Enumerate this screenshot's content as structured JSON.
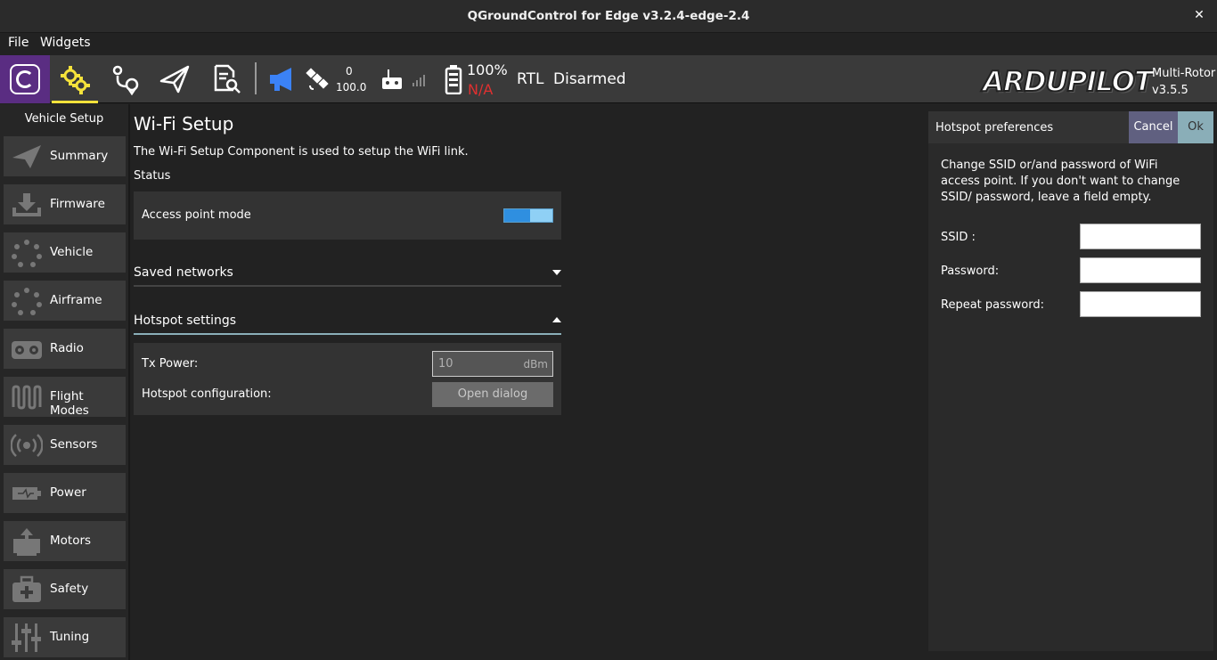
{
  "window": {
    "title": "QGroundControl for Edge v3.2.4-edge-2.4",
    "close": "✕"
  },
  "menu": {
    "file": "File",
    "widgets": "Widgets"
  },
  "toolbar": {
    "gps_count": "0",
    "gps_hdop": "100.0",
    "battery_percent": "100%",
    "battery_voltage": "N/A",
    "flight_mode": "RTL",
    "arm_state": "Disarmed",
    "brand": "ARDUPILOT",
    "vehicle_type": "Multi-Rotor",
    "firmware_version": "v3.5.5",
    "colors": {
      "accent": "#f5e23b",
      "battery_warning": "#e03030",
      "logo_bg": "#5a2d82",
      "announcer": "#3b82f6"
    }
  },
  "sidebar": {
    "title": "Vehicle Setup",
    "items": [
      {
        "label": "Summary",
        "icon": "paper-plane-icon"
      },
      {
        "label": "Firmware",
        "icon": "download-icon"
      },
      {
        "label": "Vehicle",
        "icon": "dots-circle-icon"
      },
      {
        "label": "Airframe",
        "icon": "dots-circle-icon"
      },
      {
        "label": "Radio",
        "icon": "radio-transmitter-icon"
      },
      {
        "label": "Flight Modes",
        "icon": "wave-icon"
      },
      {
        "label": "Sensors",
        "icon": "sensor-icon"
      },
      {
        "label": "Power",
        "icon": "battery-icon"
      },
      {
        "label": "Motors",
        "icon": "motor-icon"
      },
      {
        "label": "Safety",
        "icon": "first-aid-icon"
      },
      {
        "label": "Tuning",
        "icon": "sliders-icon"
      }
    ]
  },
  "main": {
    "title": "Wi-Fi Setup",
    "description": "The Wi-Fi Setup Component is used to setup the WiFi link.",
    "status_label": "Status",
    "access_point": {
      "label": "Access point mode",
      "enabled": true
    },
    "saved_networks": {
      "label": "Saved networks",
      "expanded": false
    },
    "hotspot_settings": {
      "label": "Hotspot settings",
      "expanded": true,
      "tx_power_label": "Tx Power:",
      "tx_power_value": "10",
      "tx_power_unit": "dBm",
      "config_label": "Hotspot configuration:",
      "open_dialog_label": "Open dialog"
    }
  },
  "dialog": {
    "title": "Hotspot preferences",
    "cancel": "Cancel",
    "ok": "Ok",
    "description": "Change SSID or/and password of WiFi access point. If you don't want to change SSID/ password, leave a field empty.",
    "ssid_label": "SSID :",
    "ssid_value": "",
    "password_label": "Password:",
    "password_value": "",
    "repeat_label": "Repeat password:",
    "repeat_value": ""
  }
}
